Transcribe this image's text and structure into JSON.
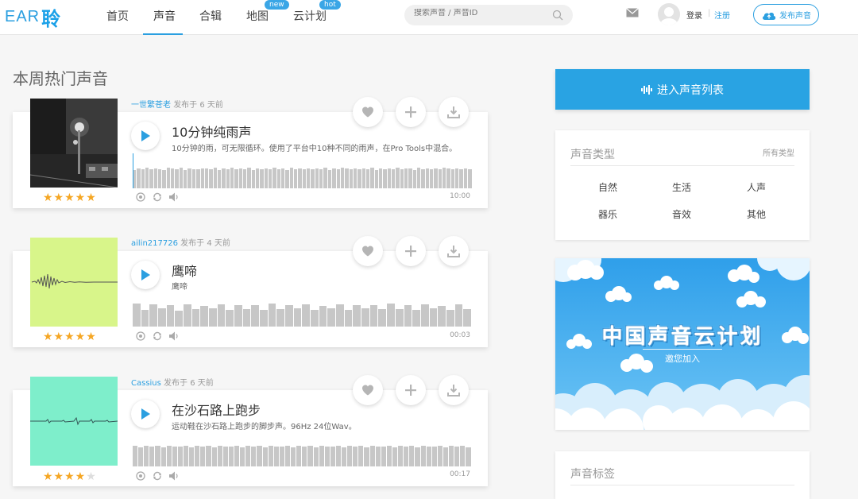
{
  "header": {
    "logo_latin": "EAR",
    "logo_cn": "聆",
    "nav": [
      {
        "label": "首页",
        "active": false
      },
      {
        "label": "声音",
        "active": true
      },
      {
        "label": "合辑",
        "active": false
      },
      {
        "label": "地图",
        "active": false,
        "badge": "new"
      },
      {
        "label": "云计划",
        "active": false,
        "badge": "hot"
      }
    ],
    "search_placeholder": "搜索声音 / 声音ID",
    "login": "登录",
    "separator": "|",
    "register": "注册",
    "publish": "发布声音"
  },
  "main": {
    "section_title": "本周热门声音",
    "published_suffix": "发布于",
    "sounds": [
      {
        "author": "一世繁苍老",
        "time": "6 天前",
        "title": "10分钟纯雨声",
        "description": "10分钟的雨，可无限循环。使用了平台中10种不同的雨声，在Pro Tools中混合。",
        "duration": "10:00",
        "rating": 5
      },
      {
        "author": "ailin217726",
        "time": "4 天前",
        "title": "鹰啼",
        "description": "鹰啼",
        "duration": "00:03",
        "rating": 5
      },
      {
        "author": "Cassius",
        "time": "6 天前",
        "title": "在沙石路上跑步",
        "description": "运动鞋在沙石路上跑步的脚步声。96Hz 24位Wav。",
        "duration": "00:17",
        "rating": 4
      }
    ]
  },
  "sidebar": {
    "enter_list": "进入声音列表",
    "sound_types_title": "声音类型",
    "all_types": "所有类型",
    "types": [
      "自然",
      "生活",
      "人声",
      "器乐",
      "音效",
      "其他"
    ],
    "banner_title": "中国声音云计划",
    "banner_sub": "邀您加入",
    "tags_title": "声音标签"
  },
  "colors": {
    "accent": "#2b9fe0",
    "star": "#f5a623",
    "thumb_green": "#d8f58a",
    "thumb_teal": "#7eeecb",
    "banner_sky": "#3aa8ec"
  }
}
